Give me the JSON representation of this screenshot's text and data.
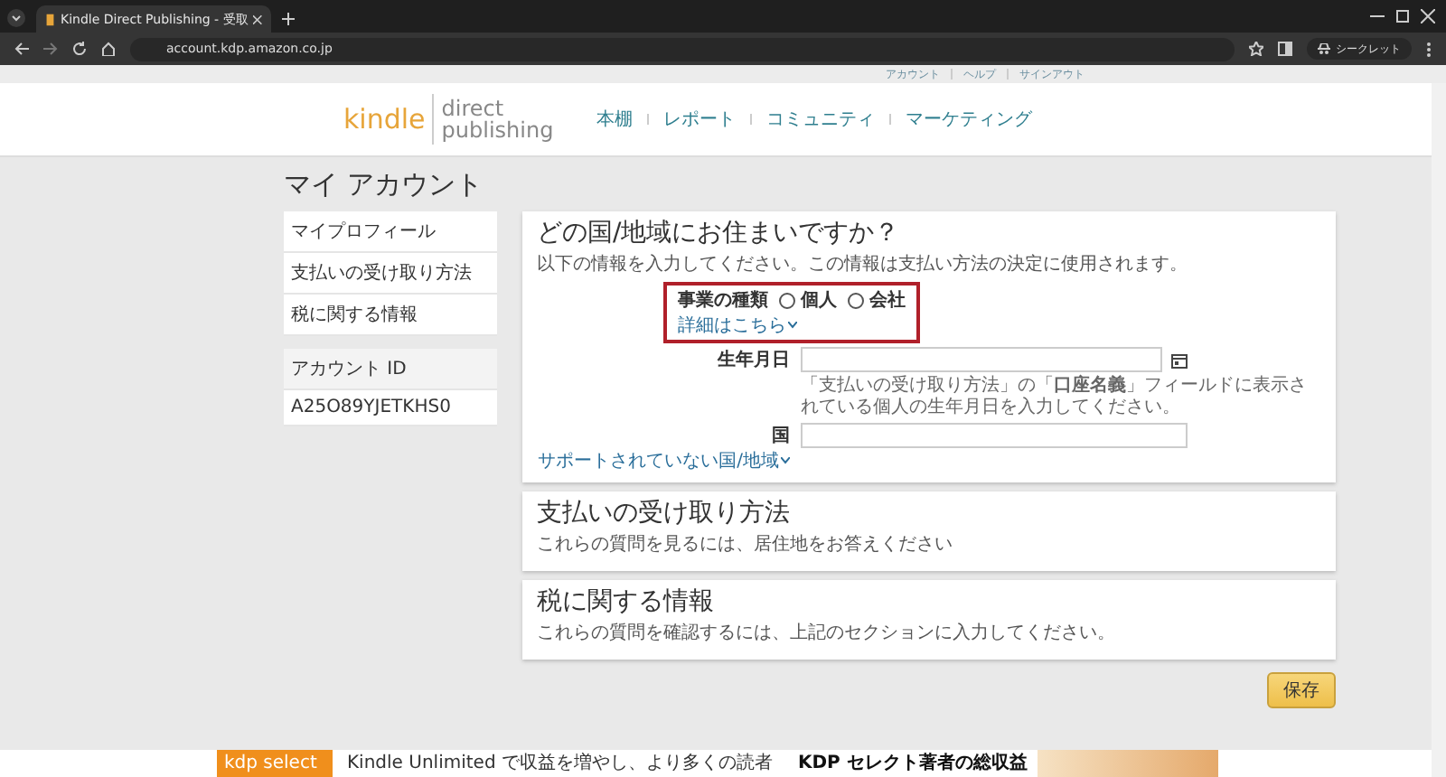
{
  "browser": {
    "tab_title": "Kindle Direct Publishing - 受取",
    "url": "account.kdp.amazon.co.jp",
    "profile": "シークレット"
  },
  "top_links": [
    "アカウント",
    "ヘルプ",
    "サインアウト"
  ],
  "logo": {
    "brand": "kindle",
    "line1": "direct",
    "line2": "publishing"
  },
  "nav": [
    "本棚",
    "レポート",
    "コミュニティ",
    "マーケティング"
  ],
  "page_title": "マイ アカウント",
  "sidebar": {
    "menu": [
      "マイプロフィール",
      "支払いの受け取り方法",
      "税に関する情報"
    ],
    "account_label": "アカウント ID",
    "account_id": "A25O89YJETKHS0"
  },
  "residence": {
    "title": "どの国/地域にお住まいですか？",
    "subtitle": "以下の情報を入力してください。この情報は支払い方法の決定に使用されます。",
    "business_type": {
      "label": "事業の種類",
      "link": "詳細はこちら",
      "highlighted": true,
      "options": [
        {
          "label": "個人",
          "selected": false
        },
        {
          "label": "会社",
          "selected": false
        }
      ]
    },
    "birthdate": {
      "label": "生年月日",
      "hint": "「支払いの受け取り方法」の「**口座名義**」フィールドに表示されている個人の生年月日を入力してください。"
    },
    "country": {
      "label": "国",
      "link": "サポートされていない国/地域"
    }
  },
  "sections": [
    {
      "title": "支払いの受け取り方法",
      "subtitle": "これらの質問を見るには、居住地をお答えください"
    },
    {
      "title": "税に関する情報",
      "subtitle": "これらの質問を確認するには、上記のセクションに入力してください。"
    }
  ],
  "save_button": "保存",
  "banner": {
    "logo": "kdp select",
    "text": "Kindle Unlimited で収益を増やし、より多くの読者",
    "headline": "KDP セレクト著者の総収益"
  }
}
